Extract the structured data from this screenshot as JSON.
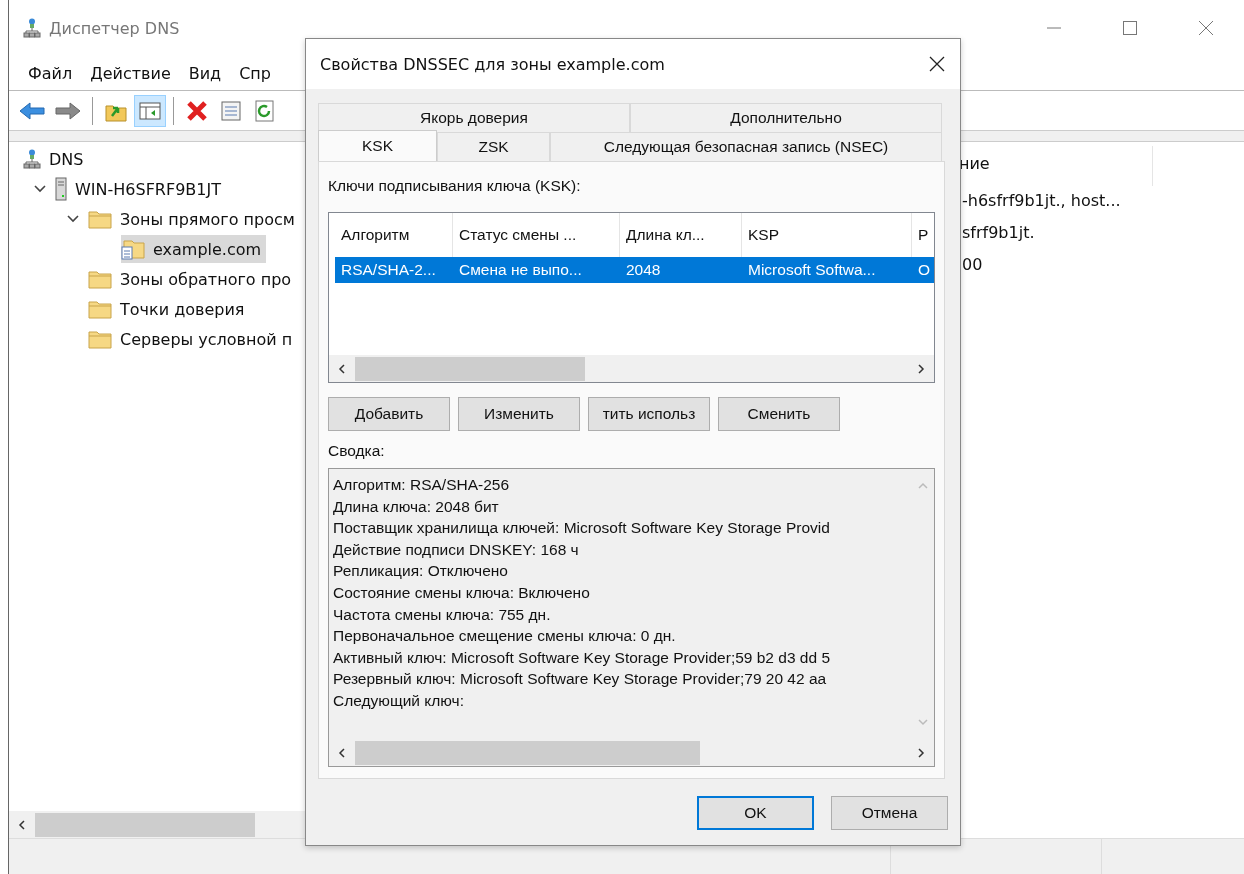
{
  "main_window": {
    "title": "Диспетчер DNS",
    "menu": [
      "Файл",
      "Действие",
      "Вид",
      "Спр"
    ],
    "toolbar_groups": [
      [
        {
          "kind": "back",
          "pressed": false
        },
        {
          "kind": "forward",
          "pressed": false
        }
      ],
      [
        {
          "kind": "up",
          "pressed": false
        },
        {
          "kind": "pane",
          "pressed": true
        }
      ],
      [
        {
          "kind": "delete",
          "pressed": false
        },
        {
          "kind": "properties",
          "pressed": false
        },
        {
          "kind": "refresh",
          "pressed": false
        }
      ]
    ],
    "tree": [
      {
        "label": "DNS",
        "kind": "dns",
        "selected": false,
        "children": [
          {
            "label": "WIN-H6SFRF9B1JT",
            "kind": "server",
            "expanded": true,
            "selected": false,
            "children": [
              {
                "label": "Зоны прямого просм",
                "kind": "folder",
                "expanded": true,
                "selected": false,
                "children": [
                  {
                    "label": "example.com",
                    "kind": "zone",
                    "expanded": false,
                    "selected": true
                  }
                ]
              },
              {
                "label": "Зоны обратного про",
                "kind": "folder",
                "expanded": false,
                "selected": false
              },
              {
                "label": "Точки доверия",
                "kind": "folder",
                "expanded": false,
                "selected": false
              },
              {
                "label": "Серверы условной п",
                "kind": "folder",
                "expanded": false,
                "selected": false
              }
            ]
          }
        ]
      }
    ],
    "details": {
      "column_header": "ние",
      "rows": [
        "-h6sfrf9b1jt., host...",
        "sfrf9b1jt.",
        "00"
      ]
    }
  },
  "dialog": {
    "title": "Свойства DNSSEC для зоны example.com",
    "tab_rows": [
      [
        {
          "label": "Якорь доверия",
          "selected": false
        },
        {
          "label": "Дополнительно",
          "selected": false
        }
      ],
      [
        {
          "label": "KSK",
          "selected": true
        },
        {
          "label": "ZSK",
          "selected": false
        },
        {
          "label": "Следующая безопасная запись (NSEC)",
          "selected": false
        }
      ]
    ],
    "keys_label": "Ключи подписывания ключа (KSK):",
    "key_list": {
      "columns": [
        "Алгоритм",
        "Статус смены ...",
        "Длина кл...",
        "KSP",
        "Р"
      ],
      "rows": [
        {
          "cells": [
            "RSA/SHA-2...",
            "Смена не выпо...",
            "2048",
            "Microsoft Softwa...",
            "О"
          ],
          "selected": true
        }
      ]
    },
    "key_buttons": [
      "Добавить",
      "Изменить",
      "тить использ",
      "Сменить"
    ],
    "summary_label": "Сводка:",
    "summary_lines": [
      "Алгоритм: RSA/SHA-256",
      "Длина ключа: 2048 бит",
      "Поставщик хранилища ключей: Microsoft Software Key Storage Provid",
      "Действие подписи DNSKEY: 168 ч",
      "Репликация: Отключено",
      "Состояние смены ключа: Включено",
      "Частота смены ключа: 755 дн.",
      "Первоначальное смещение смены ключа: 0 дн.",
      "Активный ключ: Microsoft Software Key Storage Provider;59 b2 d3 dd 5",
      "Резервный ключ: Microsoft Software Key Storage Provider;79 20 42 aa",
      "Следующий ключ:"
    ],
    "buttons": [
      {
        "label": "OK",
        "default": true
      },
      {
        "label": "Отмена",
        "default": false
      }
    ]
  }
}
